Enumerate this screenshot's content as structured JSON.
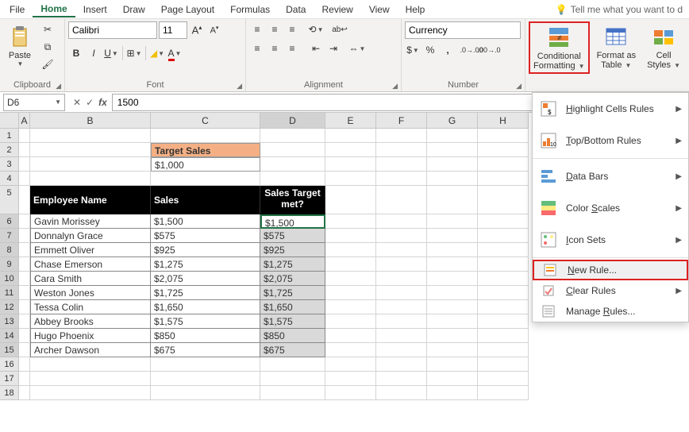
{
  "menubar": {
    "items": [
      "File",
      "Home",
      "Insert",
      "Draw",
      "Page Layout",
      "Formulas",
      "Data",
      "Review",
      "View",
      "Help"
    ],
    "active": "Home",
    "tellme": "Tell me what you want to d"
  },
  "ribbon": {
    "clipboard": {
      "label": "Clipboard",
      "paste": "Paste"
    },
    "font": {
      "label": "Font",
      "name": "Calibri",
      "size": "11",
      "buttons": [
        "B",
        "I",
        "U"
      ]
    },
    "alignment": {
      "label": "Alignment"
    },
    "number": {
      "label": "Number",
      "format": "Currency"
    },
    "styles": {
      "conditional": "Conditional",
      "formatting": "Formatting",
      "format_as": "Format as",
      "table": "Table",
      "cell": "Cell",
      "styles_l": "Styles"
    }
  },
  "namebox": "D6",
  "formula": "1500",
  "columns": [
    "A",
    "B",
    "C",
    "D",
    "E",
    "F",
    "G",
    "H"
  ],
  "target_label": "Target Sales",
  "target_value": "$1,000",
  "headers": {
    "b": "Employee Name",
    "c": "Sales",
    "d": "Sales Target met?"
  },
  "data": [
    {
      "name": "Gavin Morissey",
      "sales": "$1,500",
      "met": "$1,500"
    },
    {
      "name": "Donnalyn Grace",
      "sales": "$575",
      "met": "$575"
    },
    {
      "name": "Emmett Oliver",
      "sales": "$925",
      "met": "$925"
    },
    {
      "name": "Chase Emerson",
      "sales": "$1,275",
      "met": "$1,275"
    },
    {
      "name": "Cara Smith",
      "sales": "$2,075",
      "met": "$2,075"
    },
    {
      "name": "Weston Jones",
      "sales": "$1,725",
      "met": "$1,725"
    },
    {
      "name": "Tessa Colin",
      "sales": "$1,650",
      "met": "$1,650"
    },
    {
      "name": "Abbey Brooks",
      "sales": "$1,575",
      "met": "$1,575"
    },
    {
      "name": "Hugo Phoenix",
      "sales": "$850",
      "met": "$850"
    },
    {
      "name": "Archer Dawson",
      "sales": "$675",
      "met": "$675"
    }
  ],
  "menu": {
    "highlight": "Highlight Cells Rules",
    "topbottom": "Top/Bottom Rules",
    "databars": "Data Bars",
    "colorscales": "Color Scales",
    "iconsets": "Icon Sets",
    "newrule": "New Rule...",
    "clear": "Clear Rules",
    "manage": "Manage Rules..."
  }
}
